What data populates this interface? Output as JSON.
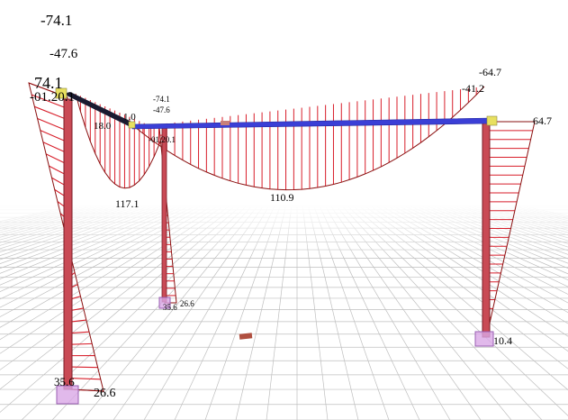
{
  "colors": {
    "diagram": "#d81e2a",
    "diagram_outline": "#8a1010",
    "beam": "#3b3fd6",
    "column": "#c94a55",
    "grid": "#bfbfbf",
    "node": "#e8e060",
    "support": "#d9a8e6"
  },
  "labels": {
    "tl_top": "-74.1",
    "tl_mid": "-47.6",
    "tl_big": "74.1",
    "tl_node": "-01.20.1",
    "left_span_end": "18.0",
    "left_span_end2": "1.0",
    "mid_top": "-74.1",
    "mid_mid": "-47.6",
    "mid_node": "-01.20.1",
    "left_span_max": "117.1",
    "main_span_max": "110.9",
    "right_top": "-64.7",
    "right_mid": "-41.2",
    "right_node": "64.7",
    "mid_base_a": "26.6",
    "mid_base_b": "35.6",
    "left_base_a": "35.6",
    "left_base_b": "26.6",
    "right_base": "10.4"
  }
}
